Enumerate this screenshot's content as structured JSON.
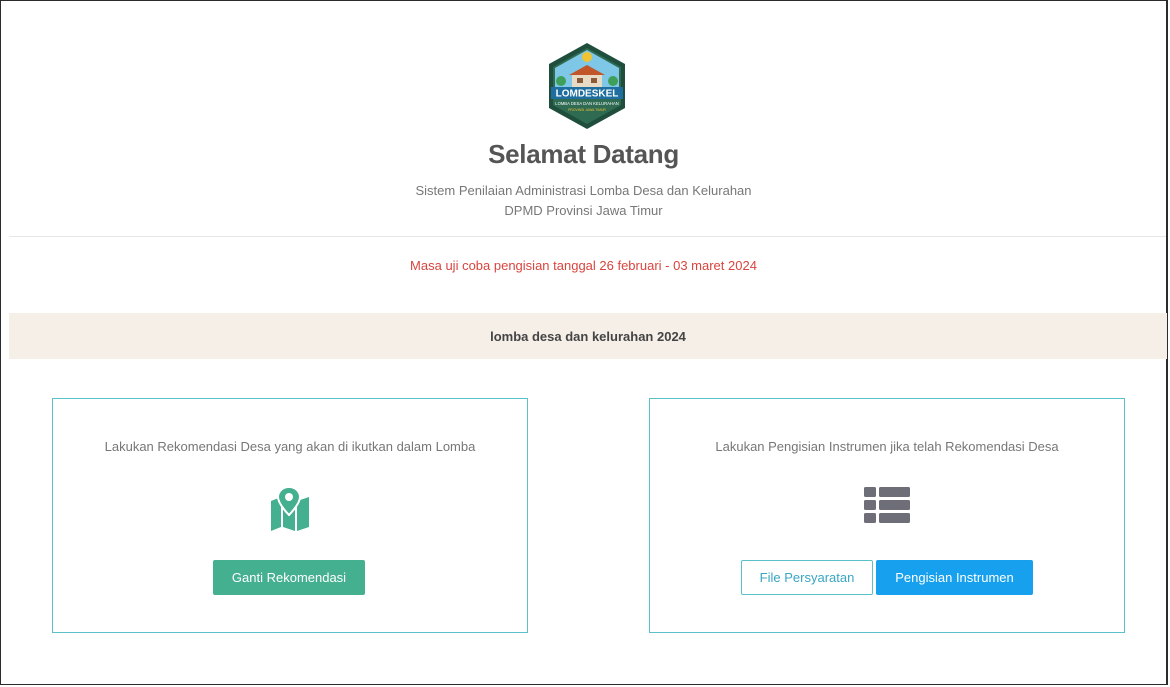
{
  "header": {
    "logo": {
      "name": "lomdeskel-logo",
      "text_main": "LOMDESKEL",
      "text_sub": "LOMBA DESA DAN KELURAHAN",
      "text_small": "PROVINSI JAWA TIMUR"
    },
    "title": "Selamat Datang",
    "subtitle_line1": "Sistem Penilaian Administrasi Lomba Desa dan Kelurahan",
    "subtitle_line2": "DPMD Provinsi Jawa Timur"
  },
  "notice": "Masa uji coba pengisian tanggal 26 februari - 03 maret 2024",
  "banner": "lomba desa dan kelurahan 2024",
  "cards": {
    "recommendation": {
      "text": "Lakukan Rekomendasi Desa yang akan di ikutkan dalam Lomba",
      "icon": "map-marker-icon",
      "button_label": "Ganti Rekomendasi"
    },
    "instrument": {
      "text": "Lakukan Pengisian Instrumen jika telah Rekomendasi Desa",
      "icon": "list-icon",
      "button_files_label": "File Persyaratan",
      "button_fill_label": "Pengisian Instrumen"
    }
  },
  "colors": {
    "accent_green": "#45b08f",
    "accent_blue": "#16a0ee",
    "notice_red": "#d9453e",
    "card_border": "#5bc0c8",
    "banner_bg": "#f5efe8"
  }
}
